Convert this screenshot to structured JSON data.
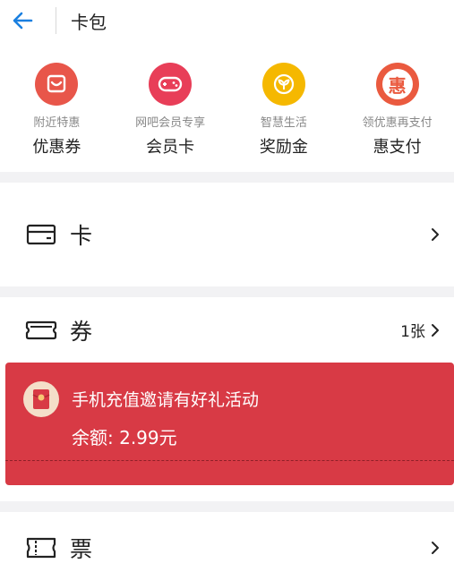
{
  "header": {
    "title": "卡包",
    "back_icon": "back-arrow-icon",
    "accent": "#1a7fe0"
  },
  "quick_links": [
    {
      "sub": "附近特惠",
      "label": "优惠券",
      "icon": "smile-bag-icon",
      "color": "#e8564a"
    },
    {
      "sub": "网吧会员专享",
      "label": "会员卡",
      "icon": "gamepad-icon",
      "color": "#e83e58"
    },
    {
      "sub": "智慧生活",
      "label": "奖励金",
      "icon": "sprout-icon",
      "color": "#f5b800"
    },
    {
      "sub": "领优惠再支付",
      "label": "惠支付",
      "icon": "hui-icon",
      "glyph": "惠",
      "color": "#ea5a3f"
    }
  ],
  "sections": {
    "card": {
      "label": "卡",
      "icon": "card-icon"
    },
    "coupon": {
      "label": "券",
      "icon": "ticket-icon",
      "count": "1张"
    },
    "ticket": {
      "label": "票",
      "icon": "ticket-stub-icon"
    }
  },
  "coupon_item": {
    "title": "手机充值邀请有好礼活动",
    "balance": "余额: 2.99元",
    "icon": "red-envelope-icon",
    "color": "#d83a45"
  }
}
